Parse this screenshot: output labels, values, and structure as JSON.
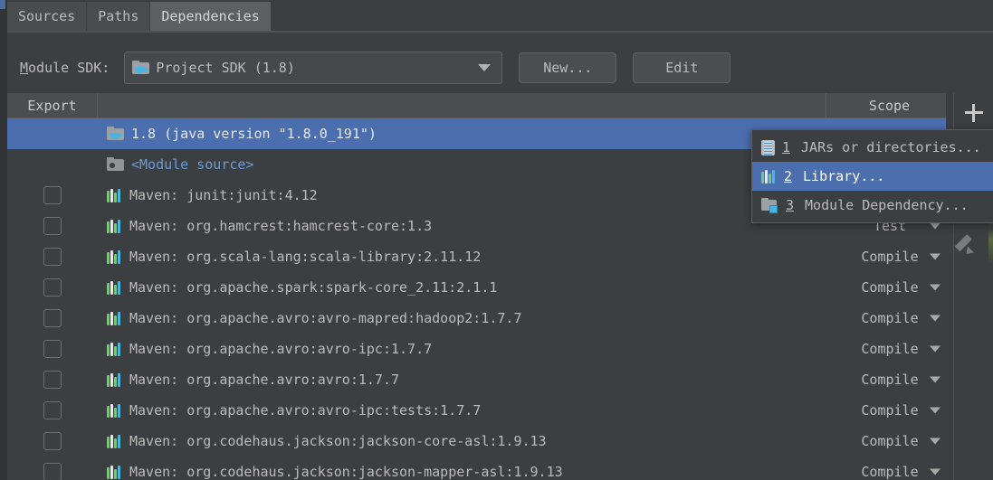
{
  "tabs": [
    {
      "label": "Sources",
      "active": false
    },
    {
      "label": "Paths",
      "active": false
    },
    {
      "label": "Dependencies",
      "active": true
    }
  ],
  "sdk": {
    "label": "Module SDK:",
    "label_mnemonic": "M",
    "label_rest": "odule SDK:",
    "value": "Project SDK (1.8)",
    "icon": "folder-java-icon",
    "new_button": "New...",
    "edit_button": "Edit"
  },
  "table": {
    "headers": {
      "export": "Export",
      "name": "",
      "scope": "Scope"
    },
    "rows": [
      {
        "checkbox": false,
        "has_checkbox": false,
        "icon": "sdk-icon",
        "name": "1.8 (java version \"1.8.0_191\")",
        "scope": "",
        "selected": true,
        "blue_text": false
      },
      {
        "checkbox": false,
        "has_checkbox": false,
        "icon": "module-icon",
        "name": "<Module source>",
        "scope": "",
        "selected": false,
        "blue_text": true
      },
      {
        "checkbox": false,
        "has_checkbox": true,
        "icon": "library-icon",
        "name": "Maven: junit:junit:4.12",
        "scope": "",
        "selected": false,
        "blue_text": false
      },
      {
        "checkbox": false,
        "has_checkbox": true,
        "icon": "library-icon",
        "name": "Maven: org.hamcrest:hamcrest-core:1.3",
        "scope": "Test",
        "selected": false,
        "blue_text": false
      },
      {
        "checkbox": false,
        "has_checkbox": true,
        "icon": "library-icon",
        "name": "Maven: org.scala-lang:scala-library:2.11.12",
        "scope": "Compile",
        "selected": false,
        "blue_text": false
      },
      {
        "checkbox": false,
        "has_checkbox": true,
        "icon": "library-icon",
        "name": "Maven: org.apache.spark:spark-core_2.11:2.1.1",
        "scope": "Compile",
        "selected": false,
        "blue_text": false
      },
      {
        "checkbox": false,
        "has_checkbox": true,
        "icon": "library-icon",
        "name": "Maven: org.apache.avro:avro-mapred:hadoop2:1.7.7",
        "scope": "Compile",
        "selected": false,
        "blue_text": false
      },
      {
        "checkbox": false,
        "has_checkbox": true,
        "icon": "library-icon",
        "name": "Maven: org.apache.avro:avro-ipc:1.7.7",
        "scope": "Compile",
        "selected": false,
        "blue_text": false
      },
      {
        "checkbox": false,
        "has_checkbox": true,
        "icon": "library-icon",
        "name": "Maven: org.apache.avro:avro:1.7.7",
        "scope": "Compile",
        "selected": false,
        "blue_text": false
      },
      {
        "checkbox": false,
        "has_checkbox": true,
        "icon": "library-icon",
        "name": "Maven: org.apache.avro:avro-ipc:tests:1.7.7",
        "scope": "Compile",
        "selected": false,
        "blue_text": false
      },
      {
        "checkbox": false,
        "has_checkbox": true,
        "icon": "library-icon",
        "name": "Maven: org.codehaus.jackson:jackson-core-asl:1.9.13",
        "scope": "Compile",
        "selected": false,
        "blue_text": false
      },
      {
        "checkbox": false,
        "has_checkbox": true,
        "icon": "library-icon",
        "name": "Maven: org.codehaus.jackson:jackson-mapper-asl:1.9.13",
        "scope": "Compile",
        "selected": false,
        "blue_text": false
      }
    ]
  },
  "toolbar": {
    "add_label": "+",
    "add_icon": "plus-icon",
    "edit_icon": "pencil-icon",
    "sort_icon": "chevron-down-icon"
  },
  "popup": {
    "items": [
      {
        "number": "1",
        "label": "JARs or directories...",
        "icon": "jar-icon",
        "highlighted": false
      },
      {
        "number": "2",
        "label": "Library...",
        "icon": "library-icon",
        "highlighted": true
      },
      {
        "number": "3",
        "label": "Module Dependency...",
        "icon": "module-dependency-icon",
        "highlighted": false
      }
    ]
  },
  "colors": {
    "background": "#3c3f41",
    "selection": "#4b6eaf",
    "header": "#4b4e50",
    "text": "#bbbbbb",
    "link": "#6a9bd8"
  }
}
